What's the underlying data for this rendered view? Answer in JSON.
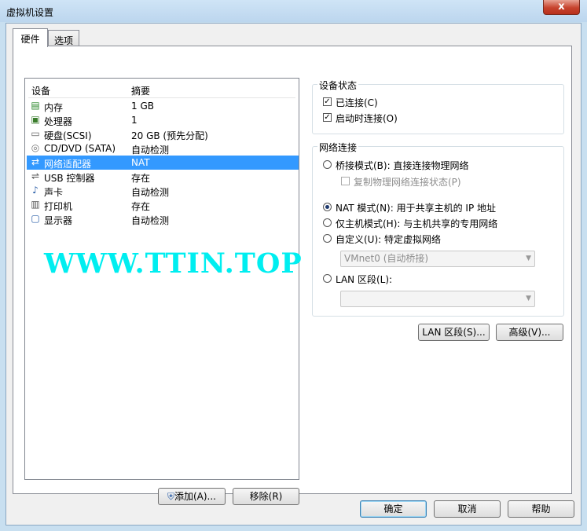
{
  "window": {
    "title": "虚拟机设置",
    "close_glyph": "x"
  },
  "tabs": [
    {
      "label": "硬件"
    },
    {
      "label": "选项"
    }
  ],
  "device_list": {
    "headers": {
      "device": "设备",
      "summary": "摘要"
    },
    "rows": [
      {
        "name": "内存",
        "summary": "1 GB",
        "icon": "memory-icon"
      },
      {
        "name": "处理器",
        "summary": "1",
        "icon": "processor-icon"
      },
      {
        "name": "硬盘(SCSI)",
        "summary": "20 GB (预先分配)",
        "icon": "harddisk-icon"
      },
      {
        "name": "CD/DVD (SATA)",
        "summary": "自动检测",
        "icon": "cd-dvd-icon"
      },
      {
        "name": "网络适配器",
        "summary": "NAT",
        "icon": "network-adapter-icon",
        "selected": true
      },
      {
        "name": "USB 控制器",
        "summary": "存在",
        "icon": "usb-icon"
      },
      {
        "name": "声卡",
        "summary": "自动检测",
        "icon": "sound-card-icon"
      },
      {
        "name": "打印机",
        "summary": "存在",
        "icon": "printer-icon"
      },
      {
        "name": "显示器",
        "summary": "自动检测",
        "icon": "display-icon"
      }
    ]
  },
  "watermark": "WWW.TTIN.TOP",
  "buttons": {
    "add": "添加(A)...",
    "remove": "移除(R)",
    "lan_segments": "LAN 区段(S)...",
    "advanced": "高级(V)...",
    "ok": "确定",
    "cancel": "取消",
    "help": "帮助"
  },
  "device_status": {
    "title": "设备状态",
    "connected": {
      "label": "已连接(C)",
      "checked": true
    },
    "connect_at_power_on": {
      "label": "启动时连接(O)",
      "checked": true
    }
  },
  "network_connection": {
    "title": "网络连接",
    "bridged": {
      "label": "桥接模式(B): 直接连接物理网络",
      "checked": false
    },
    "replicate": {
      "label": "复制物理网络连接状态(P)",
      "checked": false
    },
    "nat": {
      "label": "NAT 模式(N): 用于共享主机的 IP 地址",
      "checked": true
    },
    "host_only": {
      "label": "仅主机模式(H): 与主机共享的专用网络",
      "checked": false
    },
    "custom": {
      "label": "自定义(U): 特定虚拟网络",
      "checked": false
    },
    "custom_value": "VMnet0 (自动桥接)",
    "lan_segment": {
      "label": "LAN 区段(L):",
      "checked": false
    },
    "lan_segment_value": ""
  },
  "colors": {
    "selection": "#3399ff",
    "watermark": "#00eef0",
    "title_bar": "#c8dff0"
  }
}
